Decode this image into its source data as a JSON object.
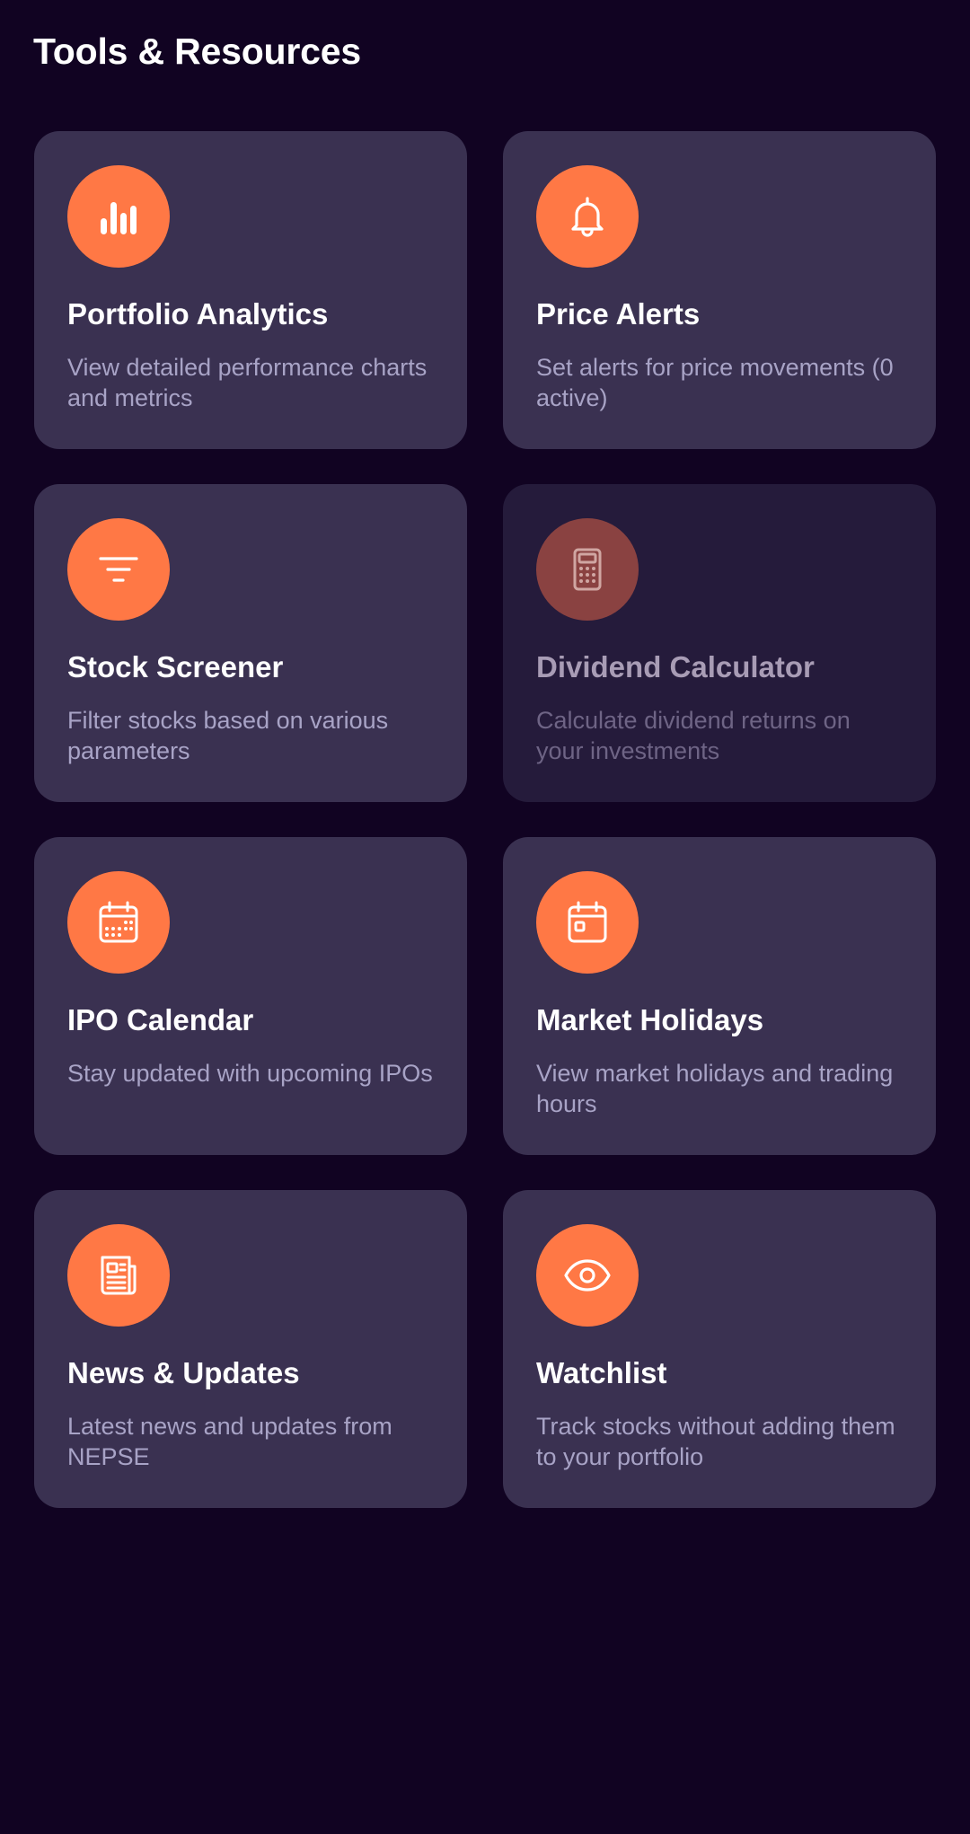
{
  "header": {
    "title": "Tools & Resources"
  },
  "colors": {
    "background": "#110322",
    "card": "#3a3151",
    "card_disabled": "#251b3b",
    "accent": "#ff7845",
    "accent_disabled": "#8a4241",
    "description": "#a8a3c6"
  },
  "tools": [
    {
      "title": "Portfolio Analytics",
      "description": "View detailed performance charts and metrics",
      "icon": "bar-chart-icon",
      "enabled": true
    },
    {
      "title": "Price Alerts",
      "description": "Set alerts for price movements (0 active)",
      "icon": "bell-icon",
      "enabled": true
    },
    {
      "title": "Stock Screener",
      "description": "Filter stocks based on various parameters",
      "icon": "filter-icon",
      "enabled": true
    },
    {
      "title": "Dividend Calculator",
      "description": "Calculate dividend returns on your investments",
      "icon": "calculator-icon",
      "enabled": false
    },
    {
      "title": "IPO Calendar",
      "description": "Stay updated with upcoming IPOs",
      "icon": "calendar-icon",
      "enabled": true
    },
    {
      "title": "Market Holidays",
      "description": "View market holidays and trading hours",
      "icon": "calendar-event-icon",
      "enabled": true
    },
    {
      "title": "News & Updates",
      "description": "Latest news and updates from NEPSE",
      "icon": "newspaper-icon",
      "enabled": true
    },
    {
      "title": "Watchlist",
      "description": "Track stocks without adding them to your portfolio",
      "icon": "eye-icon",
      "enabled": true
    }
  ]
}
